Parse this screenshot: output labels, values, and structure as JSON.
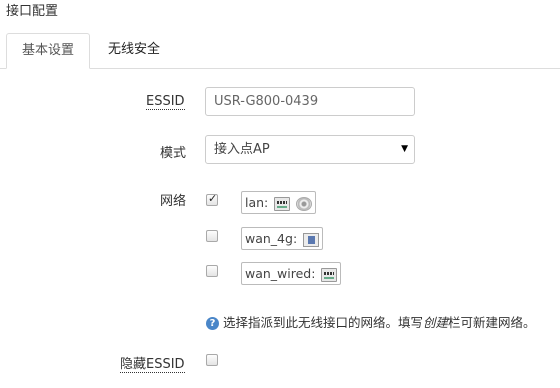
{
  "section": {
    "title": "接口配置"
  },
  "tabs": [
    {
      "label": "基本设置",
      "active": true
    },
    {
      "label": "无线安全",
      "active": false
    }
  ],
  "form": {
    "essid": {
      "label": "ESSID",
      "placeholder": "USR-G800-0439",
      "value": ""
    },
    "mode": {
      "label": "模式",
      "selected": "接入点AP"
    },
    "network": {
      "label": "网络",
      "options": [
        {
          "name": "lan:",
          "checked": true,
          "icons": [
            "switch-icon",
            "wifi-icon"
          ]
        },
        {
          "name": "wan_4g:",
          "checked": false,
          "icons": [
            "modem-icon"
          ]
        },
        {
          "name": "wan_wired:",
          "checked": false,
          "icons": [
            "switch-icon"
          ]
        }
      ],
      "help_prefix": "选择指派到此无线接口的网络。填写",
      "help_em": "创建",
      "help_suffix": "栏可新建网络。"
    },
    "hide_essid": {
      "label": "隐藏ESSID",
      "checked": false
    }
  }
}
